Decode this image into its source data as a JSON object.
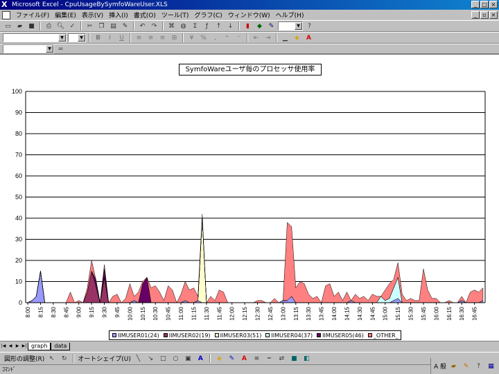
{
  "window": {
    "title": "Microsoft Excel - CpuUsageBySymfoWareUser.XLS"
  },
  "menu": [
    "ファイル(F)",
    "編集(E)",
    "表示(V)",
    "挿入(I)",
    "書式(O)",
    "ツール(T)",
    "グラフ(C)",
    "ウィンドウ(W)",
    "ヘルプ(H)"
  ],
  "sheets": [
    "graph",
    "data"
  ],
  "drawbar": {
    "adjust": "図形の調整(R)",
    "autoshape": "オートシェイプ(U)"
  },
  "status": "ｺﾏﾝﾄﾞ",
  "tray_ime": "A 般",
  "colors": {
    "IIMUSER01": "#9999ff",
    "IIMUSER02": "#993366",
    "IIMUSER03": "#ffffcc",
    "IIMUSER04": "#ccffff",
    "IIMUSER05": "#660066",
    "OTHER": "#ff8080"
  },
  "chart_data": {
    "type": "area",
    "title": "SymfoWareユーザ毎のプロセッサ使用率",
    "ylim": [
      0,
      100
    ],
    "yticks": [
      "0",
      "10",
      "20",
      "30",
      "40",
      "50",
      "60",
      "70",
      "80",
      "90",
      "100"
    ],
    "xtick_labels": [
      "8:00",
      "8:15",
      "8:30",
      "8:45",
      "9:00",
      "9:15",
      "9:30",
      "9:45",
      "10:00",
      "10:15",
      "10:30",
      "10:45",
      "11:00",
      "11:15",
      "11:30",
      "11:45",
      "12:00",
      "12:15",
      "12:30",
      "12:45",
      "13:00",
      "13:15",
      "13:30",
      "13:45",
      "14:00",
      "14:15",
      "14:30",
      "14:45",
      "15:00",
      "15:15",
      "15:30",
      "15:45",
      "16:00",
      "16:15",
      "16:30",
      "16:45"
    ],
    "grid": true,
    "legend_position": "bottom",
    "x": [
      "8:00",
      "8:05",
      "8:10",
      "8:15",
      "8:20",
      "8:25",
      "8:30",
      "8:35",
      "8:40",
      "8:45",
      "8:50",
      "8:55",
      "9:00",
      "9:05",
      "9:10",
      "9:15",
      "9:20",
      "9:25",
      "9:30",
      "9:35",
      "9:40",
      "9:45",
      "9:50",
      "9:55",
      "10:00",
      "10:05",
      "10:10",
      "10:15",
      "10:20",
      "10:25",
      "10:30",
      "10:35",
      "10:40",
      "10:45",
      "10:50",
      "10:55",
      "11:00",
      "11:05",
      "11:10",
      "11:15",
      "11:20",
      "11:25",
      "11:30",
      "11:35",
      "11:40",
      "11:45",
      "11:50",
      "11:55",
      "12:00",
      "12:05",
      "12:10",
      "12:15",
      "12:20",
      "12:25",
      "12:30",
      "12:35",
      "12:40",
      "12:45",
      "12:50",
      "12:55",
      "13:00",
      "13:05",
      "13:10",
      "13:15",
      "13:20",
      "13:25",
      "13:30",
      "13:35",
      "13:40",
      "13:45",
      "13:50",
      "13:55",
      "14:00",
      "14:05",
      "14:10",
      "14:15",
      "14:20",
      "14:25",
      "14:30",
      "14:35",
      "14:40",
      "14:45",
      "14:50",
      "14:55",
      "15:00",
      "15:05",
      "15:10",
      "15:15",
      "15:20",
      "15:25",
      "15:30",
      "15:35",
      "15:40",
      "15:45",
      "15:50",
      "15:55",
      "16:00",
      "16:05",
      "16:10",
      "16:15",
      "16:20",
      "16:25",
      "16:30",
      "16:35",
      "16:40",
      "16:45",
      "16:50",
      "16:55"
    ],
    "series": [
      {
        "name": "IIMUSER01(24)",
        "values": [
          0,
          1,
          3,
          15,
          0,
          0,
          0,
          0,
          0,
          0,
          0,
          0,
          0,
          0,
          0,
          0,
          0,
          0,
          0,
          0,
          0,
          0,
          0,
          0,
          0,
          1,
          0,
          0,
          0,
          0,
          0,
          0,
          0,
          0,
          0,
          0,
          0,
          1,
          0,
          0,
          1,
          0,
          0,
          0,
          0,
          0,
          0,
          0,
          0,
          0,
          0,
          0,
          0,
          0,
          0,
          0,
          0,
          0,
          0,
          0,
          1,
          1,
          3,
          0,
          0,
          0,
          0,
          0,
          0,
          0,
          0,
          0,
          0,
          0,
          0,
          0,
          1,
          0,
          0,
          0,
          0,
          0,
          0,
          0,
          0,
          0,
          1,
          2,
          0,
          0,
          0,
          0,
          0,
          0,
          0,
          0,
          0,
          0,
          0,
          0,
          0,
          0,
          1,
          0,
          0,
          0,
          0,
          1
        ]
      },
      {
        "name": "IIMUSER02(19)",
        "values": [
          0,
          0,
          0,
          0,
          0,
          0,
          0,
          0,
          0,
          0,
          0,
          0,
          0,
          0,
          5,
          15,
          8,
          0,
          12,
          0,
          0,
          0,
          0,
          0,
          0,
          0,
          0,
          0,
          0,
          0,
          0,
          0,
          0,
          0,
          0,
          0,
          0,
          0,
          0,
          0,
          0,
          0,
          0,
          0,
          0,
          0,
          0,
          0,
          0,
          0,
          0,
          0,
          0,
          0,
          0,
          0,
          0,
          0,
          0,
          0,
          0,
          0,
          0,
          0,
          0,
          0,
          0,
          0,
          0,
          0,
          0,
          0,
          0,
          0,
          0,
          0,
          0,
          0,
          0,
          0,
          0,
          0,
          0,
          0,
          0,
          0,
          0,
          0,
          0,
          0,
          0,
          0,
          0,
          0,
          0,
          0,
          0,
          0,
          0,
          0,
          0,
          0,
          0,
          0,
          0,
          0,
          0,
          0
        ]
      },
      {
        "name": "IIMUSER03(51)",
        "values": [
          0,
          0,
          0,
          0,
          0,
          0,
          0,
          0,
          0,
          0,
          0,
          0,
          0,
          0,
          0,
          0,
          0,
          0,
          0,
          0,
          0,
          0,
          0,
          0,
          0,
          0,
          0,
          0,
          0,
          0,
          0,
          0,
          0,
          0,
          0,
          0,
          0,
          0,
          0,
          0,
          0,
          40,
          0,
          0,
          0,
          0,
          0,
          0,
          0,
          0,
          0,
          0,
          0,
          0,
          0,
          0,
          0,
          0,
          0,
          0,
          0,
          0,
          0,
          0,
          0,
          0,
          0,
          0,
          0,
          0,
          0,
          0,
          0,
          0,
          0,
          0,
          0,
          0,
          0,
          0,
          0,
          0,
          0,
          0,
          0,
          0,
          0,
          0,
          0,
          0,
          0,
          0,
          0,
          0,
          0,
          0,
          0,
          0,
          0,
          0,
          0,
          0,
          0,
          0,
          0,
          0,
          0,
          0
        ]
      },
      {
        "name": "IIMUSER04(37)",
        "values": [
          0,
          0,
          0,
          0,
          0,
          0,
          0,
          0,
          0,
          0,
          0,
          0,
          0,
          0,
          0,
          0,
          0,
          0,
          0,
          0,
          0,
          0,
          0,
          0,
          0,
          0,
          0,
          0,
          0,
          0,
          0,
          0,
          0,
          0,
          0,
          0,
          0,
          0,
          0,
          0,
          0,
          0,
          0,
          0,
          0,
          0,
          0,
          0,
          0,
          0,
          0,
          0,
          0,
          0,
          0,
          0,
          0,
          0,
          0,
          0,
          0,
          0,
          0,
          0,
          0,
          0,
          0,
          0,
          0,
          0,
          0,
          0,
          0,
          0,
          0,
          0,
          0,
          0,
          0,
          0,
          0,
          0,
          0,
          3,
          1,
          2,
          6,
          10,
          0,
          0,
          0,
          0,
          0,
          0,
          0,
          0,
          0,
          0,
          0,
          0,
          0,
          0,
          0,
          0,
          0,
          0,
          0,
          0
        ]
      },
      {
        "name": "IIMUSER05(46)",
        "values": [
          0,
          0,
          0,
          0,
          0,
          0,
          0,
          0,
          0,
          0,
          0,
          0,
          0,
          0,
          0,
          0,
          3,
          0,
          4,
          0,
          0,
          0,
          0,
          0,
          0,
          0,
          0,
          9,
          12,
          0,
          0,
          0,
          0,
          0,
          0,
          0,
          0,
          0,
          0,
          0,
          0,
          0,
          0,
          0,
          0,
          0,
          0,
          0,
          0,
          0,
          0,
          0,
          0,
          0,
          0,
          0,
          0,
          0,
          0,
          0,
          0,
          0,
          0,
          0,
          0,
          0,
          0,
          0,
          0,
          0,
          0,
          0,
          0,
          0,
          0,
          0,
          0,
          0,
          0,
          0,
          0,
          0,
          0,
          0,
          0,
          0,
          0,
          0,
          0,
          0,
          0,
          0,
          0,
          0,
          0,
          0,
          0,
          0,
          0,
          0,
          0,
          0,
          0,
          0,
          0,
          0,
          0,
          0
        ]
      },
      {
        "name": "_OTHER_",
        "values": [
          0,
          0,
          0,
          0,
          0,
          0,
          0,
          0,
          0,
          0,
          5,
          0,
          1,
          0,
          2,
          5,
          0,
          0,
          2,
          0,
          3,
          4,
          0,
          2,
          9,
          2,
          5,
          1,
          0,
          7,
          8,
          5,
          1,
          8,
          6,
          0,
          4,
          9,
          6,
          7,
          2,
          2,
          0,
          3,
          1,
          6,
          5,
          0,
          0,
          0,
          0,
          0,
          0,
          0,
          1,
          1,
          0,
          0,
          2,
          0,
          0,
          37,
          33,
          7,
          10,
          9,
          4,
          2,
          3,
          0,
          8,
          9,
          3,
          5,
          1,
          5,
          0,
          4,
          2,
          3,
          1,
          4,
          3,
          0,
          5,
          7,
          4,
          7,
          4,
          1,
          2,
          1,
          1,
          16,
          6,
          2,
          2,
          0,
          0,
          1,
          0,
          0,
          2,
          0,
          5,
          6,
          5,
          6
        ]
      }
    ]
  }
}
